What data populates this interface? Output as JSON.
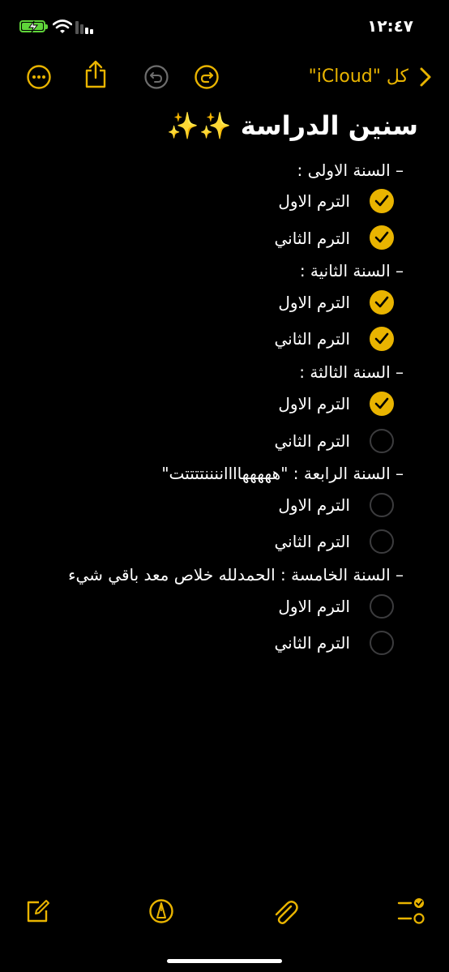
{
  "status_bar": {
    "time": "١٢:٤٧"
  },
  "nav": {
    "back_label": "كل \"iCloud\""
  },
  "note": {
    "title": "سنين الدراسة ✨✨",
    "years": [
      {
        "heading": "–   السنة الاولى :",
        "terms": [
          {
            "label": "الترم الاول",
            "checked": true
          },
          {
            "label": "الترم الثاني",
            "checked": true
          }
        ]
      },
      {
        "heading": "–   السنة الثانية :",
        "terms": [
          {
            "label": "الترم الاول",
            "checked": true
          },
          {
            "label": "الترم الثاني",
            "checked": true
          }
        ]
      },
      {
        "heading": "–   السنة الثالثة :",
        "terms": [
          {
            "label": "الترم الاول",
            "checked": true
          },
          {
            "label": "الترم الثاني",
            "checked": false
          }
        ]
      },
      {
        "heading": "–   السنة الرابعة : \"هههههااااننننتتتتت\"",
        "terms": [
          {
            "label": "الترم الاول",
            "checked": false
          },
          {
            "label": "الترم الثاني",
            "checked": false
          }
        ]
      },
      {
        "heading": "–   السنة الخامسة : الحمدلله خلاص معد باقي شيء",
        "terms": [
          {
            "label": "الترم الاول",
            "checked": false
          },
          {
            "label": "الترم الثاني",
            "checked": false
          }
        ]
      }
    ]
  },
  "colors": {
    "accent": "#e9b400",
    "background": "#000000",
    "text": "#ffffff",
    "unchecked": "#3c3c3e"
  }
}
